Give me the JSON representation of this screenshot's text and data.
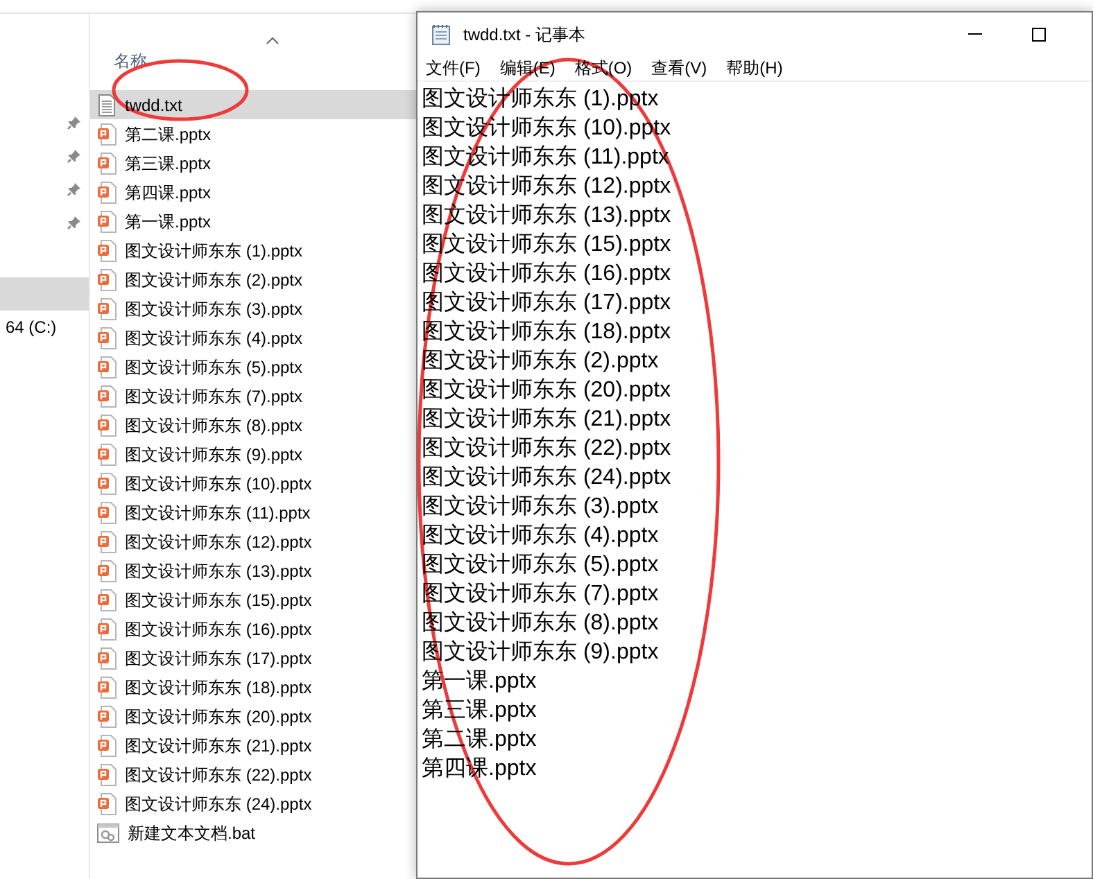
{
  "nav": {
    "items": [
      {
        "label": "64 (C:)",
        "selected": false
      }
    ]
  },
  "file_list": {
    "column": "名称",
    "files": [
      {
        "name": "twdd.txt",
        "kind": "text",
        "selected": true
      },
      {
        "name": "第二课.pptx",
        "kind": "pptx",
        "selected": false
      },
      {
        "name": "第三课.pptx",
        "kind": "pptx",
        "selected": false
      },
      {
        "name": "第四课.pptx",
        "kind": "pptx",
        "selected": false
      },
      {
        "name": "第一课.pptx",
        "kind": "pptx",
        "selected": false
      },
      {
        "name": "图文设计师东东 (1).pptx",
        "kind": "pptx",
        "selected": false
      },
      {
        "name": "图文设计师东东 (2).pptx",
        "kind": "pptx",
        "selected": false
      },
      {
        "name": "图文设计师东东 (3).pptx",
        "kind": "pptx",
        "selected": false
      },
      {
        "name": "图文设计师东东 (4).pptx",
        "kind": "pptx",
        "selected": false
      },
      {
        "name": "图文设计师东东 (5).pptx",
        "kind": "pptx",
        "selected": false
      },
      {
        "name": "图文设计师东东 (7).pptx",
        "kind": "pptx",
        "selected": false
      },
      {
        "name": "图文设计师东东 (8).pptx",
        "kind": "pptx",
        "selected": false
      },
      {
        "name": "图文设计师东东 (9).pptx",
        "kind": "pptx",
        "selected": false
      },
      {
        "name": "图文设计师东东 (10).pptx",
        "kind": "pptx",
        "selected": false
      },
      {
        "name": "图文设计师东东 (11).pptx",
        "kind": "pptx",
        "selected": false
      },
      {
        "name": "图文设计师东东 (12).pptx",
        "kind": "pptx",
        "selected": false
      },
      {
        "name": "图文设计师东东 (13).pptx",
        "kind": "pptx",
        "selected": false
      },
      {
        "name": "图文设计师东东 (15).pptx",
        "kind": "pptx",
        "selected": false
      },
      {
        "name": "图文设计师东东 (16).pptx",
        "kind": "pptx",
        "selected": false
      },
      {
        "name": "图文设计师东东 (17).pptx",
        "kind": "pptx",
        "selected": false
      },
      {
        "name": "图文设计师东东 (18).pptx",
        "kind": "pptx",
        "selected": false
      },
      {
        "name": "图文设计师东东 (20).pptx",
        "kind": "pptx",
        "selected": false
      },
      {
        "name": "图文设计师东东 (21).pptx",
        "kind": "pptx",
        "selected": false
      },
      {
        "name": "图文设计师东东 (22).pptx",
        "kind": "pptx",
        "selected": false
      },
      {
        "name": "图文设计师东东 (24).pptx",
        "kind": "pptx",
        "selected": false
      },
      {
        "name": "新建文本文档.bat",
        "kind": "bat",
        "selected": false
      }
    ]
  },
  "notepad": {
    "title": "twdd.txt - 记事本",
    "menu": [
      "文件(F)",
      "编辑(E)",
      "格式(O)",
      "查看(V)",
      "帮助(H)"
    ],
    "lines": [
      "图文设计师东东 (1).pptx",
      "图文设计师东东 (10).pptx",
      "图文设计师东东 (11).pptx",
      "图文设计师东东 (12).pptx",
      "图文设计师东东 (13).pptx",
      "图文设计师东东 (15).pptx",
      "图文设计师东东 (16).pptx",
      "图文设计师东东 (17).pptx",
      "图文设计师东东 (18).pptx",
      "图文设计师东东 (2).pptx",
      "图文设计师东东 (20).pptx",
      "图文设计师东东 (21).pptx",
      "图文设计师东东 (22).pptx",
      "图文设计师东东 (24).pptx",
      "图文设计师东东 (3).pptx",
      "图文设计师东东 (4).pptx",
      "图文设计师东东 (5).pptx",
      "图文设计师东东 (7).pptx",
      "图文设计师东东 (8).pptx",
      "图文设计师东东 (9).pptx",
      "第一课.pptx",
      "第三课.pptx",
      "第二课.pptx",
      "第四课.pptx"
    ]
  }
}
